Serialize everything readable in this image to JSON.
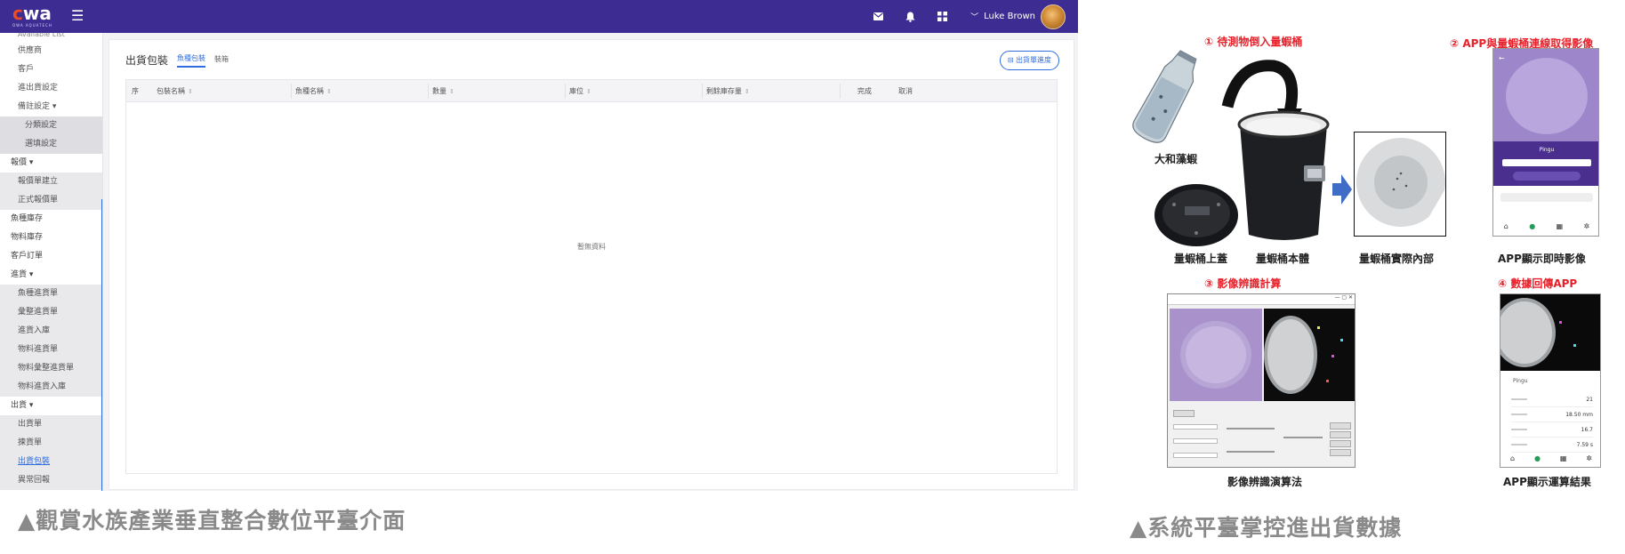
{
  "app": {
    "logo": {
      "text_main": "wa",
      "text_sub": "OWA AQUATECH"
    },
    "topbar": {
      "user_name": "Luke Brown"
    },
    "sidebar": {
      "partial_top": "Available List",
      "items": [
        {
          "label": "供應商",
          "level": "item"
        },
        {
          "label": "客戶",
          "level": "item"
        },
        {
          "label": "進出貨設定",
          "level": "item"
        },
        {
          "label": "備註設定 ▾",
          "level": "item"
        },
        {
          "label": "分類設定",
          "level": "sub2"
        },
        {
          "label": "選填設定",
          "level": "sub2"
        },
        {
          "label": "報價 ▾",
          "level": "top"
        },
        {
          "label": "報價單建立",
          "level": "sub"
        },
        {
          "label": "正式報價單",
          "level": "sub"
        },
        {
          "label": "魚種庫存",
          "level": "top"
        },
        {
          "label": "物料庫存",
          "level": "top"
        },
        {
          "label": "客戶訂單",
          "level": "top"
        },
        {
          "label": "進貨 ▾",
          "level": "top"
        },
        {
          "label": "魚種進貨單",
          "level": "sub"
        },
        {
          "label": "彙整進貨單",
          "level": "sub"
        },
        {
          "label": "進貨入庫",
          "level": "sub"
        },
        {
          "label": "物料進貨單",
          "level": "sub"
        },
        {
          "label": "物料彙整進貨單",
          "level": "sub"
        },
        {
          "label": "物料進貨入庫",
          "level": "sub"
        },
        {
          "label": "出貨 ▾",
          "level": "top"
        },
        {
          "label": "出貨單",
          "level": "sub"
        },
        {
          "label": "揀貨單",
          "level": "sub"
        },
        {
          "label": "出貨包裝",
          "level": "sub-active"
        },
        {
          "label": "異常回報",
          "level": "sub"
        }
      ]
    },
    "panel": {
      "title": "出貨包裝",
      "tabs": [
        "魚種包裝",
        "裝箱"
      ],
      "action_button": "出貨單進度",
      "columns": [
        "序",
        "包裝名稱",
        "魚種名稱",
        "數量",
        "庫位",
        "剩餘庫存量",
        "完成",
        "取消"
      ],
      "empty_text": "暫無資料"
    }
  },
  "captions": {
    "left": "▲觀賞水族產業垂直整合數位平臺介面",
    "right": "▲系統平臺掌控進出貨數據"
  },
  "diagram": {
    "step1": "① 待測物倒入量蝦桶",
    "step2": "② APP與量蝦桶連線取得影像",
    "step3": "③ 影像辨識計算",
    "step4": "④ 數據回傳APP",
    "labels": {
      "shrimp_bag": "大和藻蝦",
      "bucket_lid": "量蝦桶上蓋",
      "bucket_body": "量蝦桶本體",
      "bucket_inside": "量蝦桶實際內部",
      "app_live": "APP顯示即時影像",
      "algorithm": "影像辨識演算法",
      "app_result": "APP顯示運算結果"
    },
    "phone_app_name": "Pingu",
    "result_rows": [
      {
        "value": "21"
      },
      {
        "value": "18.50 mm"
      },
      {
        "value": "16.7"
      },
      {
        "value": "7.59 s"
      }
    ]
  }
}
